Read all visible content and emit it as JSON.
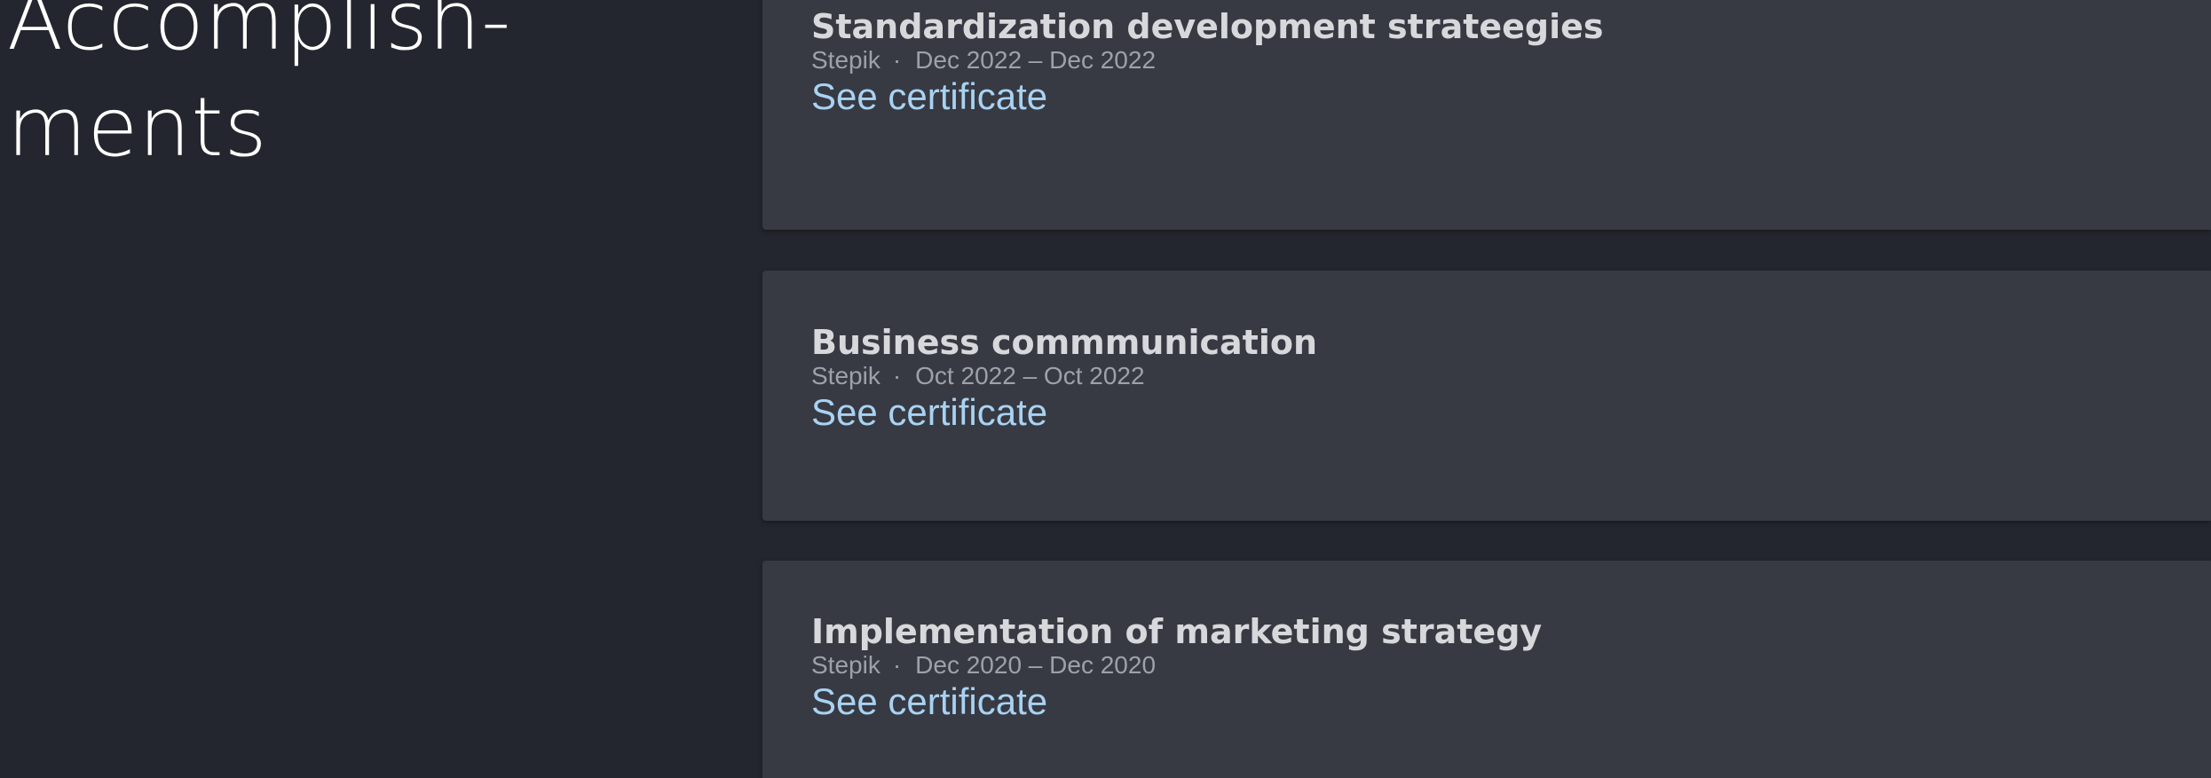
{
  "section": {
    "title_line1": "Accomplish-",
    "title_line2": "ments"
  },
  "accomplishments": [
    {
      "title": "Standardization development strateegies",
      "issuer": "Stepik",
      "separator": "·",
      "period": "Dec 2022 – Dec 2022",
      "link_label": "See certificate"
    },
    {
      "title": "Business commmunication",
      "issuer": "Stepik",
      "separator": "·",
      "period": "Oct 2022 – Oct 2022",
      "link_label": "See certificate"
    },
    {
      "title": "Implementation of marketing strategy",
      "issuer": "Stepik",
      "separator": "·",
      "period": "Dec 2020 – Dec 2020",
      "link_label": "See certificate"
    }
  ],
  "colors": {
    "background": "#23262e",
    "card": "#373a42",
    "title_text": "#d7d8db",
    "meta_text": "#9ea1a7",
    "link": "#a9d2f2",
    "heading": "#ffffff"
  }
}
